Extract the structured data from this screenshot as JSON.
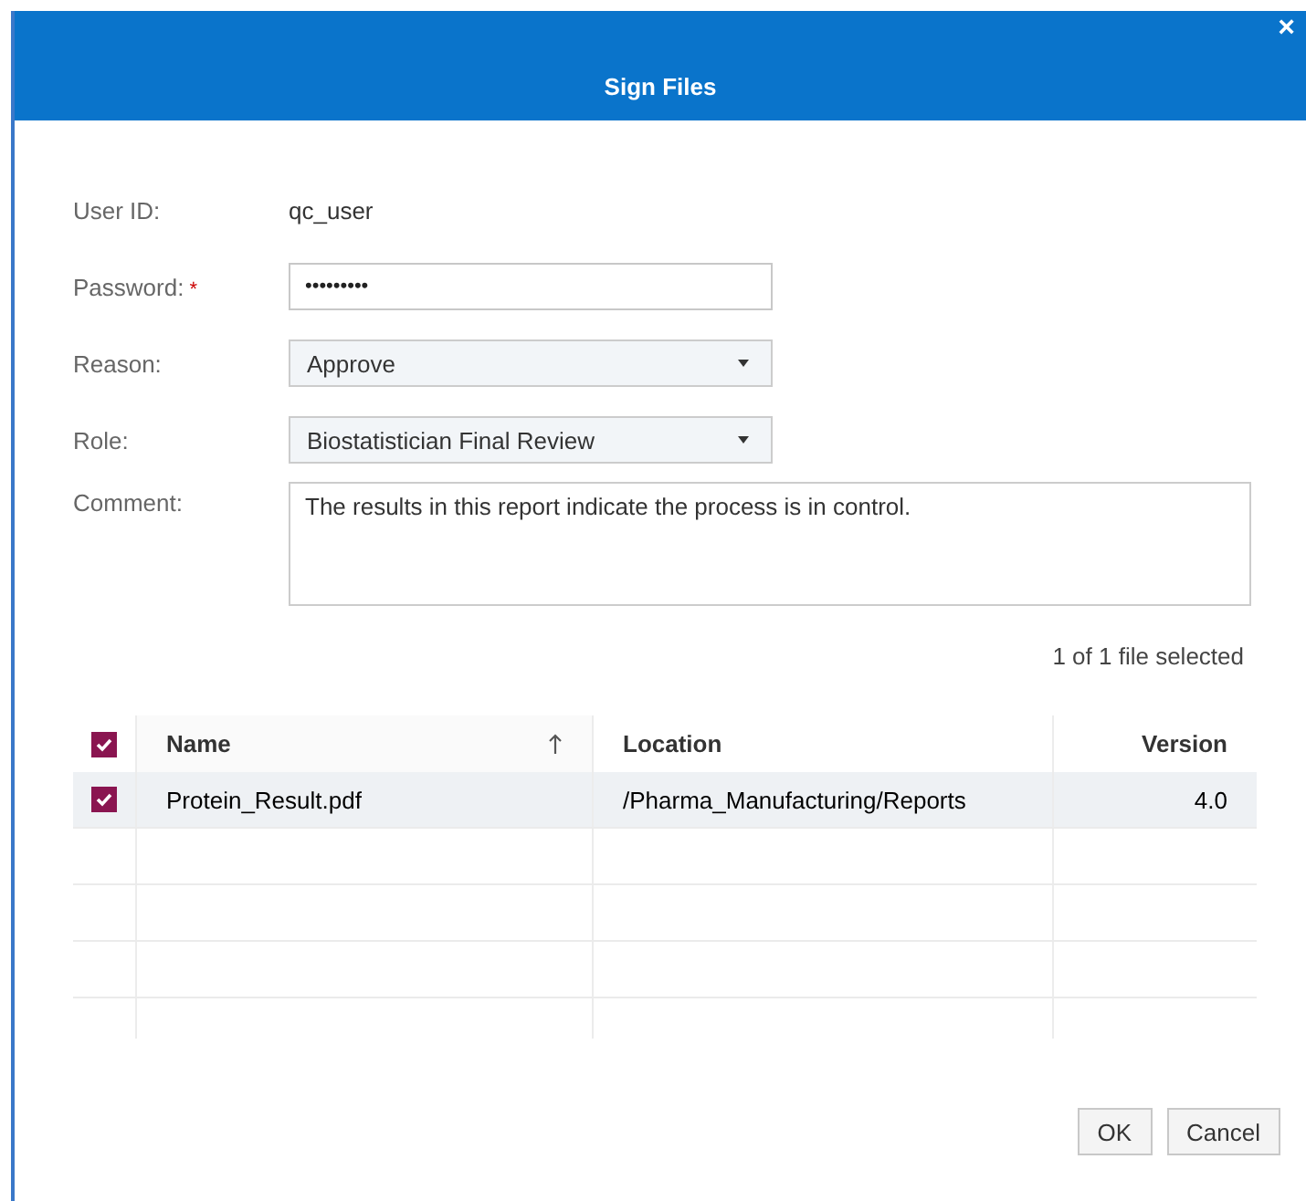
{
  "window": {
    "title": "Sign Files",
    "close": "×"
  },
  "form": [
    {
      "kind": "text",
      "label": "User ID:",
      "value": "qc_user"
    },
    {
      "kind": "password",
      "label": "Password:",
      "value": "•••••••••",
      "required_mark": "*"
    },
    {
      "kind": "select",
      "label": "Reason:",
      "value": "Approve"
    },
    {
      "kind": "select",
      "label": "Role:",
      "value": "Biostatistician Final Review"
    },
    {
      "kind": "textarea",
      "label": "Comment:",
      "value": "The results in this report indicate the process is in control."
    }
  ],
  "selection_summary": "1 of 1 file selected",
  "table": {
    "all_checked": true,
    "columns": [
      {
        "label": "Name",
        "sorted": true
      },
      {
        "label": "Location",
        "sorted": false
      },
      {
        "label": "Version",
        "sorted": false
      }
    ],
    "rows": [
      {
        "checked": true,
        "selected": true,
        "cells": [
          "Protein_Result.pdf",
          "/Pharma_Manufacturing/Reports",
          "4.0"
        ]
      }
    ]
  },
  "buttons": [
    "OK",
    "Cancel"
  ]
}
